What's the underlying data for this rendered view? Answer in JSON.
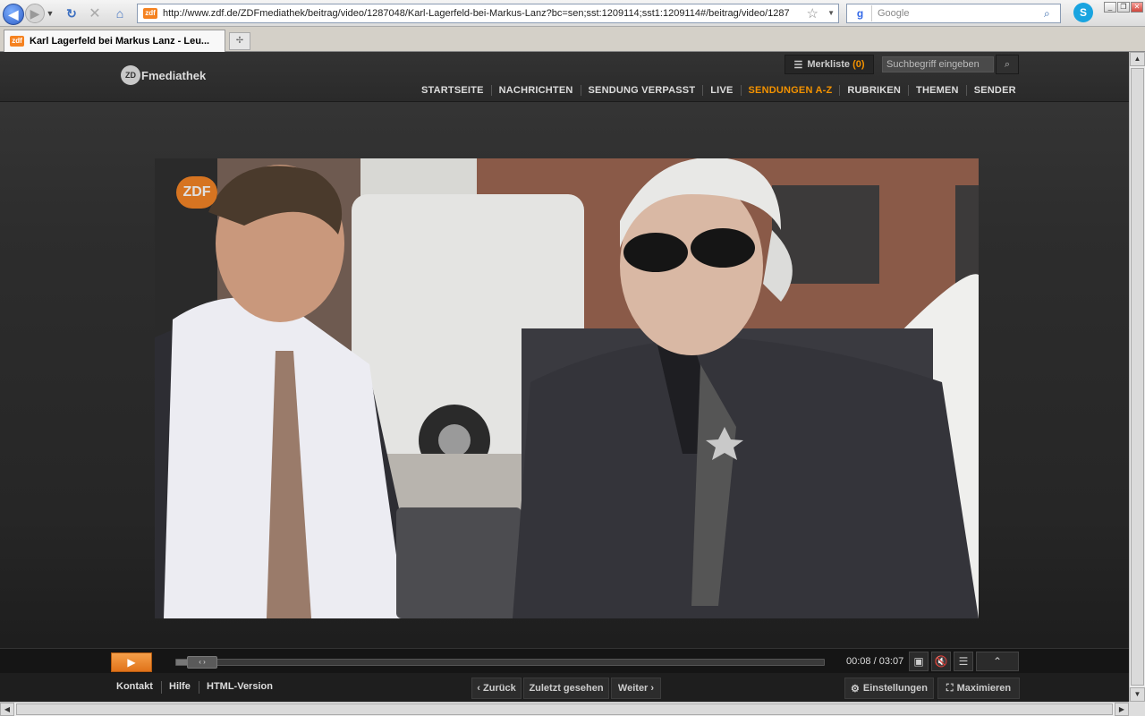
{
  "browser": {
    "url": "http://www.zdf.de/ZDFmediathek/beitrag/video/1287048/Karl-Lagerfeld-bei-Markus-Lanz?bc=sen;sst:1209114;sst1:1209114#/beitrag/video/1287",
    "search_placeholder": "Google",
    "tab_title": "Karl Lagerfeld bei Markus Lanz - Leu..."
  },
  "site": {
    "logo_text": "Fmediathek",
    "logo_badge": "ZD",
    "merkliste_label": "Merkliste",
    "merkliste_count": "(0)",
    "search_placeholder": "Suchbegriff eingeben",
    "nav": [
      {
        "label": "STARTSEITE"
      },
      {
        "label": "NACHRICHTEN"
      },
      {
        "label": "SENDUNG VERPASST"
      },
      {
        "label": "LIVE"
      },
      {
        "label": "SENDUNGEN A-Z"
      },
      {
        "label": "RUBRIKEN"
      },
      {
        "label": "THEMEN"
      },
      {
        "label": "SENDER"
      }
    ]
  },
  "player": {
    "bug": "ZDF",
    "time": "00:08 / 03:07",
    "progress": 0.043,
    "seek_handle": "‹ ›"
  },
  "footer": {
    "links": [
      "Kontakt",
      "Hilfe",
      "HTML-Version"
    ],
    "back": "‹ Zurück",
    "recent": "Zuletzt gesehen",
    "next": "Weiter ›",
    "settings": "Einstellungen",
    "maximize": "Maximieren"
  },
  "colors": {
    "accent": "#f39200"
  }
}
